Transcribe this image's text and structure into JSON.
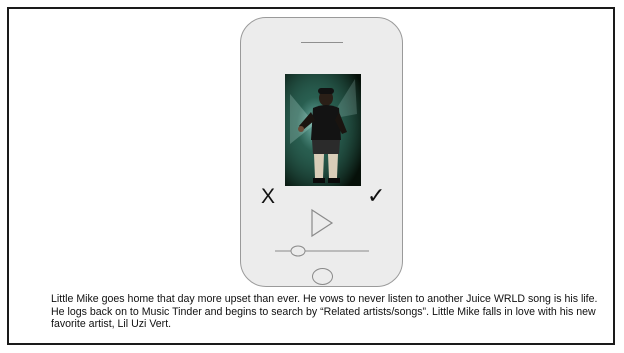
{
  "app": {
    "reject_symbol": "X",
    "accept_symbol": "✓",
    "play_icon": "play-icon",
    "seek_progress": 0.2
  },
  "story": {
    "text": "Little Mike goes home that day more upset than ever. He vows to never listen to another Juice WRLD song is his life. He logs back on to Music Tinder and begins to search by “Related artists/songs”. Little Mike falls in love with his new favorite artist, Lil Uzi Vert."
  },
  "colors": {
    "phone_body": "#ececec",
    "phone_outline": "#9a9a9a",
    "frame_border": "#1a1a1a",
    "photo_background": "#0b1a12"
  }
}
